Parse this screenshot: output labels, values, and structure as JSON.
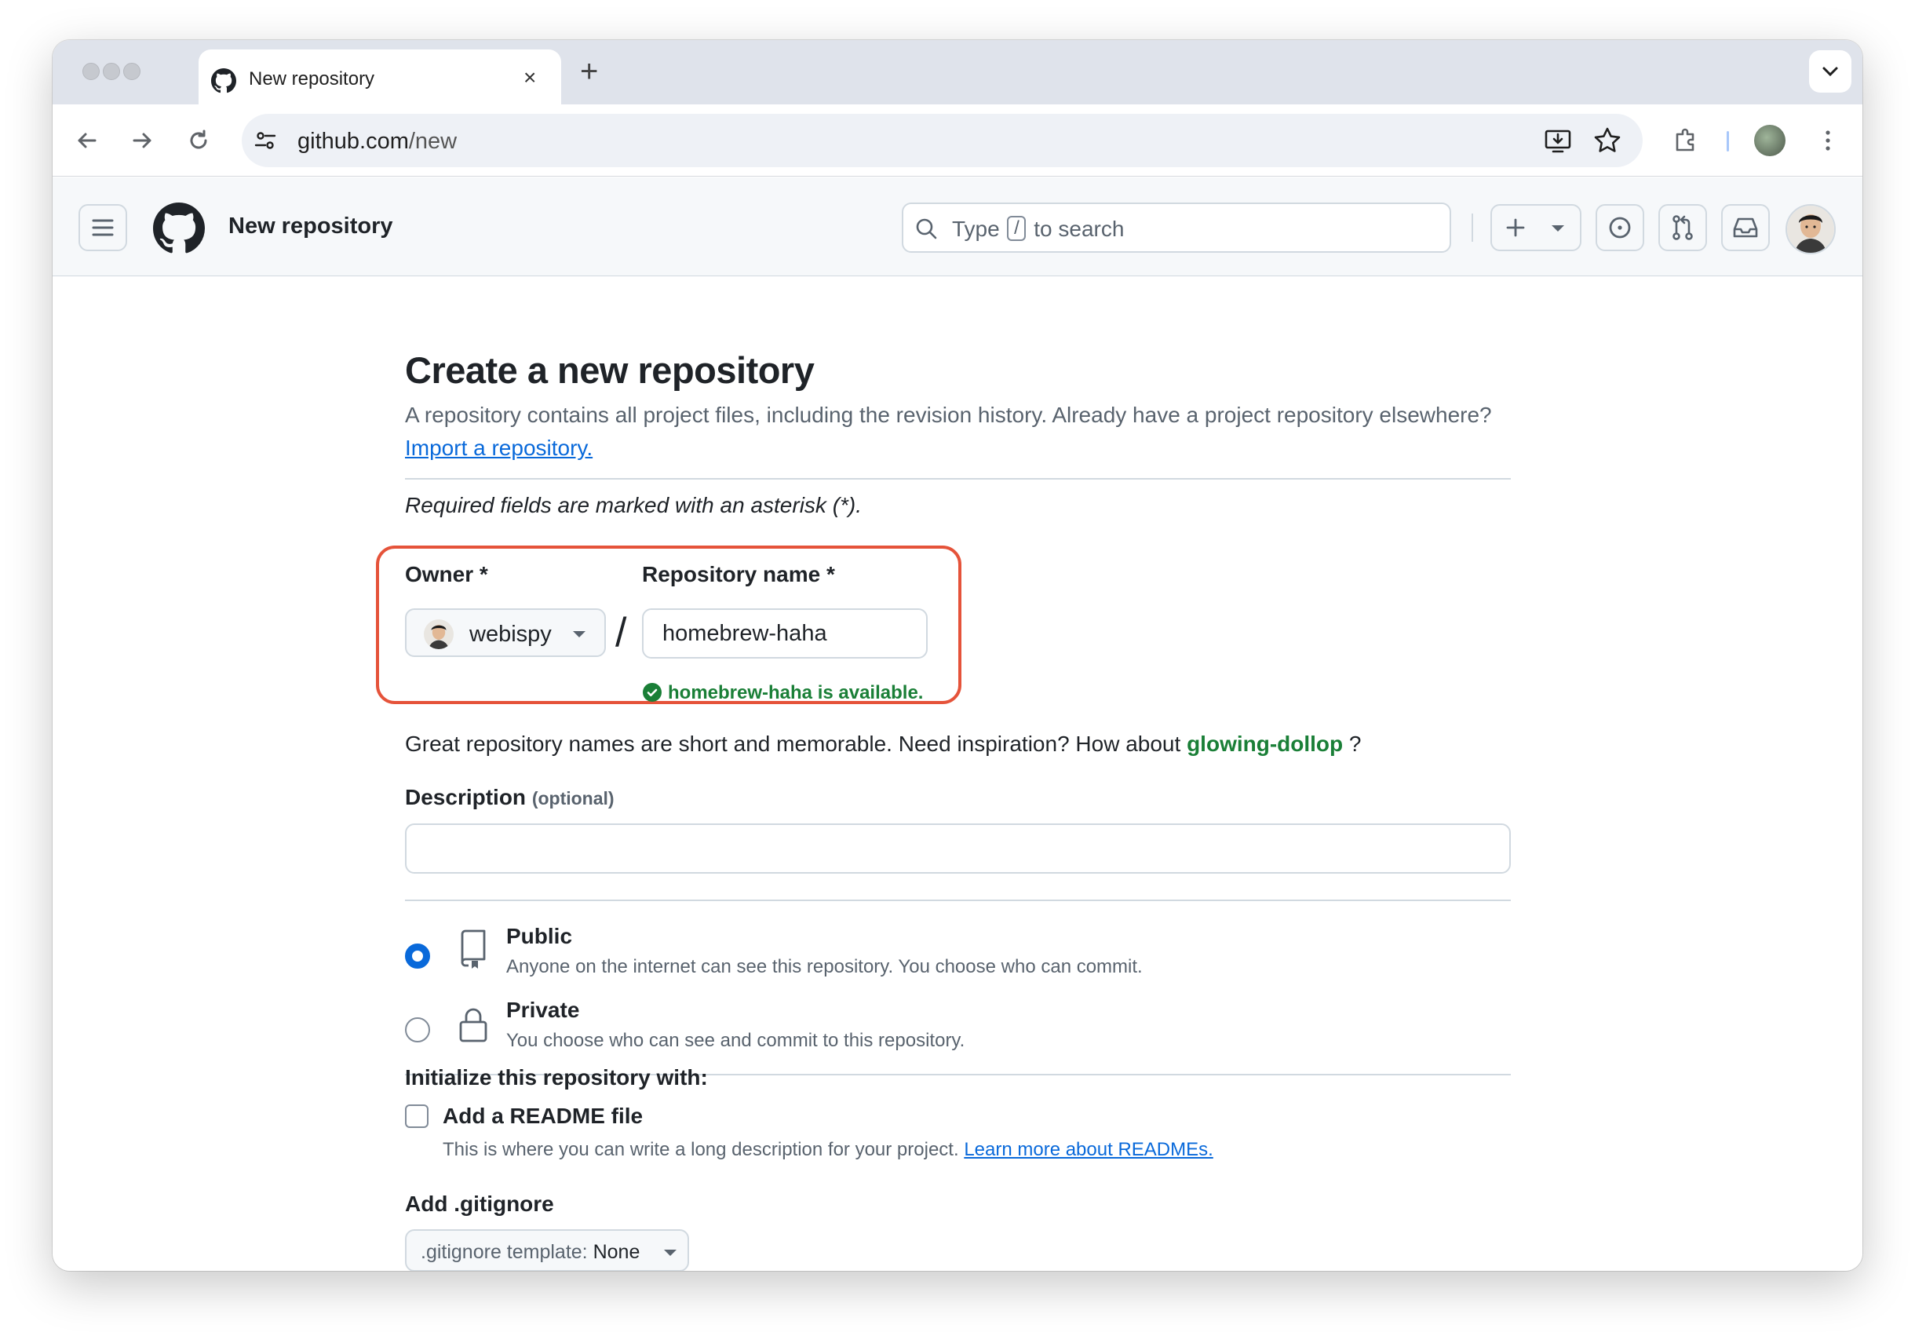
{
  "browser": {
    "tab_title": "New repository",
    "close_tab": "×",
    "new_tab": "+",
    "url_host": "github.com",
    "url_path": "/new"
  },
  "header": {
    "title": "New repository",
    "search_prefix": "Type",
    "search_key": "/",
    "search_suffix": "to search",
    "create_icon": "plus-icon",
    "issues_icon": "issue-opened-icon",
    "pulls_icon": "git-pull-request-icon",
    "inbox_icon": "inbox-icon"
  },
  "page": {
    "heading": "Create a new repository",
    "lead_text": "A repository contains all project files, including the revision history. Already have a project repository elsewhere?",
    "import_link": "Import a repository.",
    "required_note": "Required fields are marked with an asterisk (*).",
    "owner_label": "Owner *",
    "owner_value": "webispy",
    "repo_name_label": "Repository name *",
    "repo_name_value": "homebrew-haha",
    "availability": "homebrew-haha is available.",
    "suggestion_text": "Great repository names are short and memorable. Need inspiration? How about",
    "suggestion_name": "glowing-dollop",
    "suggestion_end": "?",
    "description_label": "Description",
    "description_optional": "(optional)",
    "description_value": ""
  },
  "visibility": [
    {
      "title": "Public",
      "desc": "Anyone on the internet can see this repository. You choose who can commit.",
      "selected": true,
      "icon": "repo-icon"
    },
    {
      "title": "Private",
      "desc": "You choose who can see and commit to this repository.",
      "selected": false,
      "icon": "lock-icon"
    }
  ],
  "init": {
    "heading": "Initialize this repository with:",
    "readme_label": "Add a README file",
    "readme_desc": "This is where you can write a long description for your project.",
    "readme_link": "Learn more about READMEs.",
    "readme_checked": false,
    "gitignore_label": "Add .gitignore",
    "gitignore_prefix": ".gitignore template:",
    "gitignore_value": "None"
  },
  "colors": {
    "accent": "#0969da",
    "success": "#1a7f37",
    "highlight": "#e5533a"
  }
}
